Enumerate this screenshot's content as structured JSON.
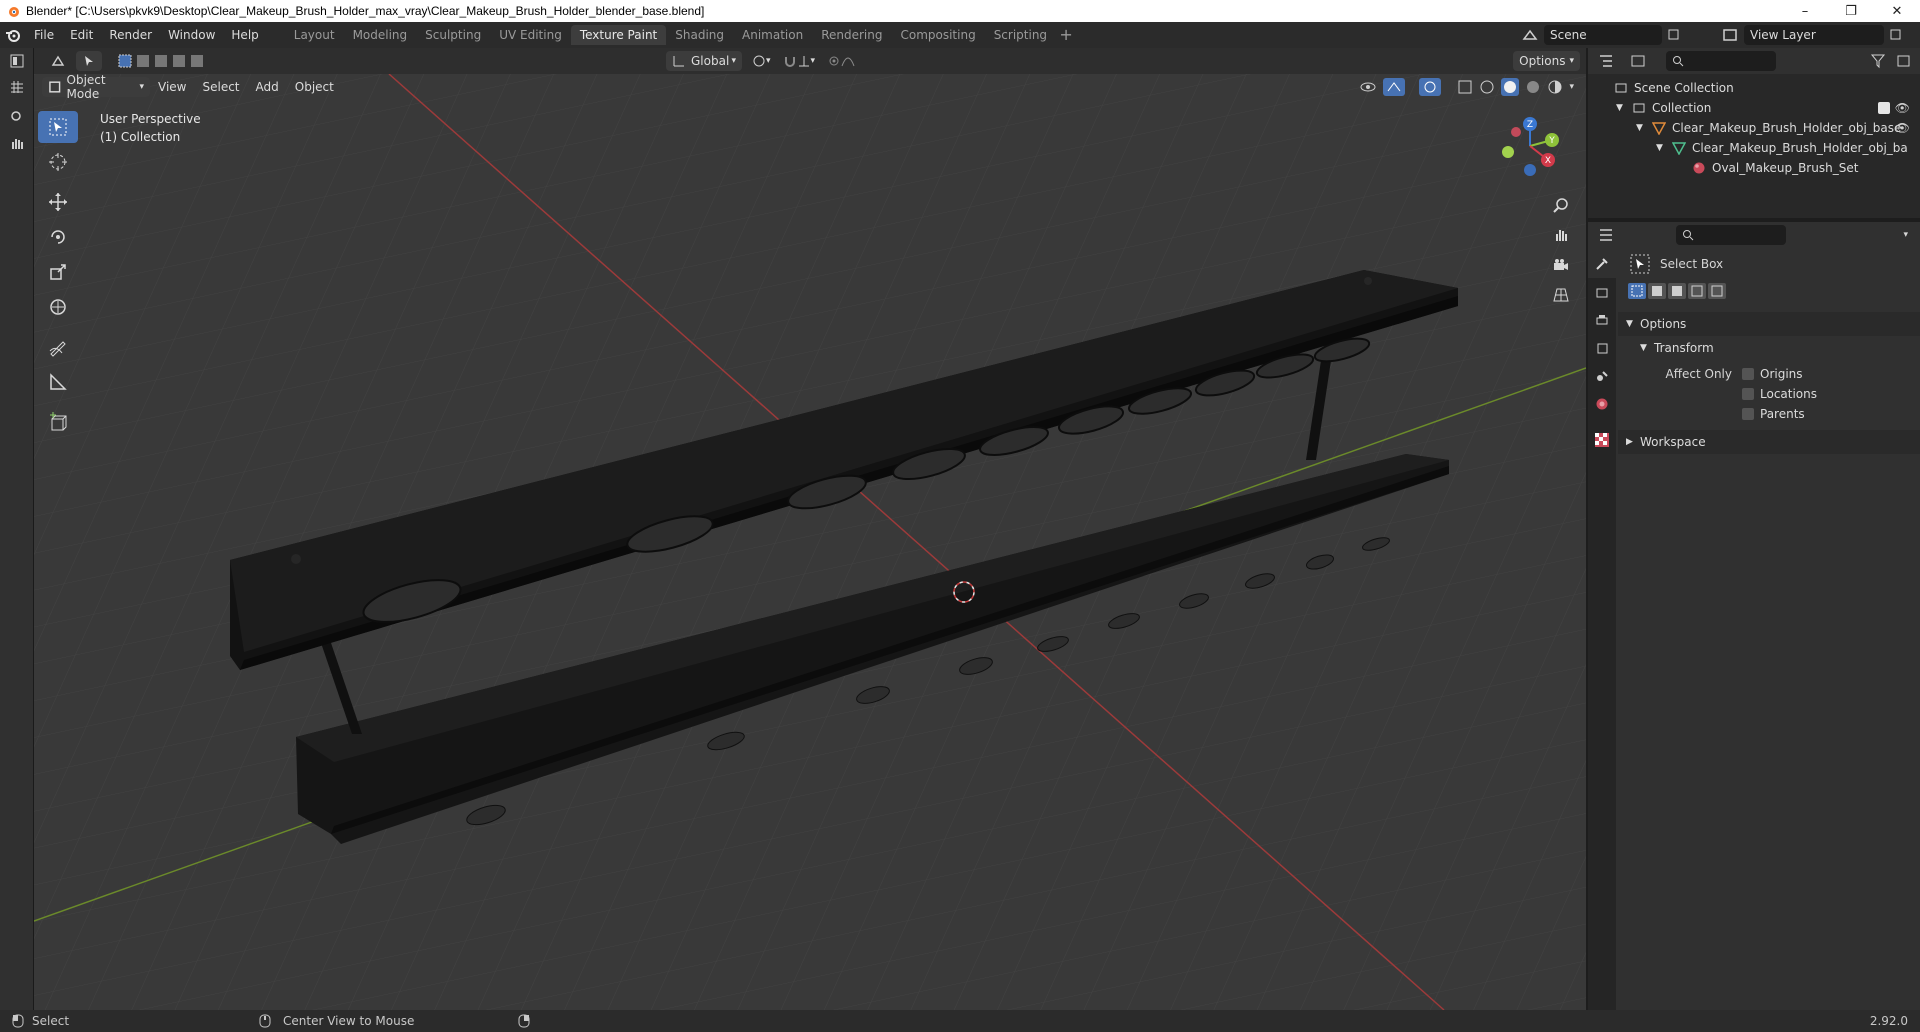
{
  "window": {
    "title": "Blender* [C:\\Users\\pkvk9\\Desktop\\Clear_Makeup_Brush_Holder_max_vray\\Clear_Makeup_Brush_Holder_blender_base.blend]",
    "minimize": "–",
    "maximize": "❐",
    "close": "✕"
  },
  "menu": [
    "File",
    "Edit",
    "Render",
    "Window",
    "Help"
  ],
  "workspaces": [
    {
      "label": "Layout",
      "active": false
    },
    {
      "label": "Modeling",
      "active": false
    },
    {
      "label": "Sculpting",
      "active": false
    },
    {
      "label": "UV Editing",
      "active": false
    },
    {
      "label": "Texture Paint",
      "active": true
    },
    {
      "label": "Shading",
      "active": false
    },
    {
      "label": "Animation",
      "active": false
    },
    {
      "label": "Rendering",
      "active": false
    },
    {
      "label": "Compositing",
      "active": false
    },
    {
      "label": "Scripting",
      "active": false
    }
  ],
  "workspace_add": "+",
  "scene": {
    "label": "Scene"
  },
  "view_layer": {
    "label": "View Layer"
  },
  "viewport_header": {
    "transform_orientation": "Global",
    "options": "Options",
    "mode": "Object Mode",
    "menus": [
      "View",
      "Select",
      "Add",
      "Object"
    ]
  },
  "viewport": {
    "perspective": "User Perspective",
    "collection": "(1) Collection",
    "gizmo": {
      "x": "X",
      "y": "Y",
      "z": "Z"
    }
  },
  "outliner": {
    "rows": [
      {
        "label": "Scene Collection",
        "indent": 0
      },
      {
        "label": "Collection",
        "indent": 1
      },
      {
        "label": "Clear_Makeup_Brush_Holder_obj_base",
        "indent": 2
      },
      {
        "label": "Clear_Makeup_Brush_Holder_obj_ba",
        "indent": 3
      },
      {
        "label": "Oval_Makeup_Brush_Set",
        "indent": 4
      }
    ]
  },
  "properties": {
    "tool_name": "Select Box",
    "options_label": "Options",
    "transform_label": "Transform",
    "affect_only_label": "Affect Only",
    "checkboxes": [
      "Origins",
      "Locations",
      "Parents"
    ],
    "workspace_label": "Workspace"
  },
  "status": {
    "select": "Select",
    "center_view": "Center View to Mouse",
    "version": "2.92.0"
  },
  "colors": {
    "accent": "#4772b3",
    "grid_x_axis": "#9c3a3a",
    "grid_y_axis": "#6b8a2a",
    "viewport_bg": "#393939",
    "object": "#141414"
  }
}
